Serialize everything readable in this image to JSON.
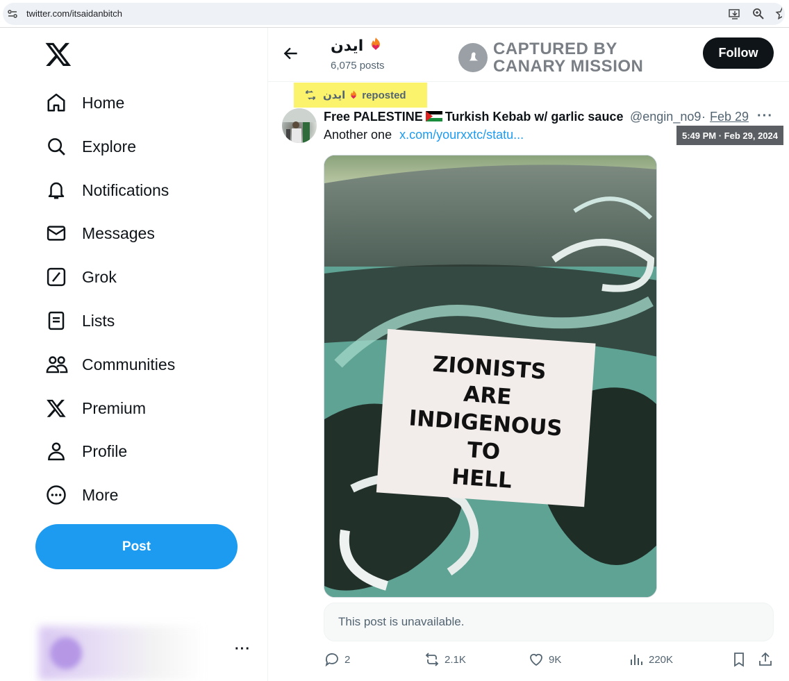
{
  "browser": {
    "url": "twitter.com/itsaidanbitch"
  },
  "sidebar": {
    "items": [
      {
        "label": "Home",
        "icon": "home-icon"
      },
      {
        "label": "Explore",
        "icon": "search-icon"
      },
      {
        "label": "Notifications",
        "icon": "bell-icon"
      },
      {
        "label": "Messages",
        "icon": "envelope-icon"
      },
      {
        "label": "Grok",
        "icon": "grok-icon"
      },
      {
        "label": "Lists",
        "icon": "list-icon"
      },
      {
        "label": "Communities",
        "icon": "people-icon"
      },
      {
        "label": "Premium",
        "icon": "x-logo-icon"
      },
      {
        "label": "Profile",
        "icon": "person-icon"
      },
      {
        "label": "More",
        "icon": "more-circle-icon"
      }
    ],
    "post_button": "Post",
    "account_more": "···"
  },
  "header": {
    "name": "ايدن",
    "posts_count": "6,075 posts",
    "watermark_line1": "CAPTURED BY",
    "watermark_line2": "CANARY MISSION",
    "follow_label": "Follow"
  },
  "tweet": {
    "repost_name": "ايدن",
    "repost_label": "reposted",
    "author_name_a": "Free PALESTINE",
    "author_name_b": "Turkish Kebab w/ garlic sauce",
    "handle": "@engin_no9",
    "separator": "·",
    "date": "Feb 29",
    "more": "···",
    "tooltip": "5:49 PM · Feb 29, 2024",
    "text": "Another one",
    "link": "x.com/yourxxtc/statu...",
    "sticker_lines": [
      "ZIONISTS",
      "ARE",
      "INDIGENOUS",
      "TO",
      "HELL"
    ],
    "quoted_unavailable": "This post is unavailable.",
    "replies": "2",
    "reposts": "2.1K",
    "likes": "9K",
    "views": "220K"
  },
  "colors": {
    "accent": "#1d9bf0",
    "highlight": "#fbf36c",
    "text_secondary": "#536471"
  }
}
